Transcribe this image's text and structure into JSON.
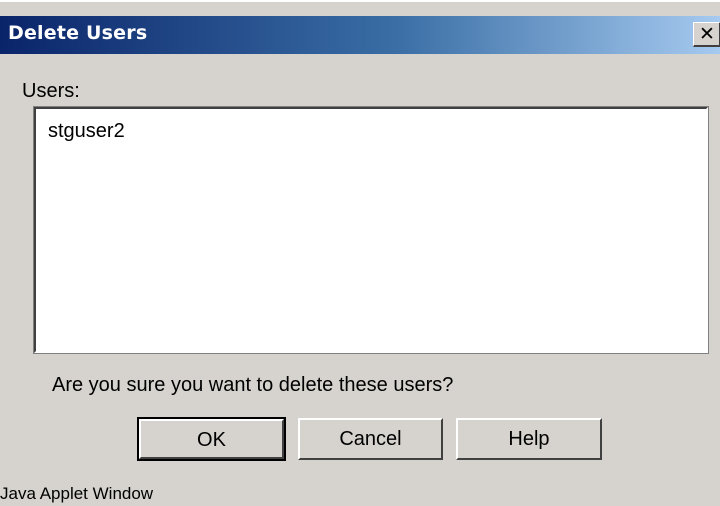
{
  "dialog": {
    "title": "Delete Users",
    "close_icon": "close-icon"
  },
  "users_label": "Users:",
  "users": [
    "stguser2"
  ],
  "confirm_message": "Are you sure you want to delete these users?",
  "buttons": {
    "ok": "OK",
    "cancel": "Cancel",
    "help": "Help"
  },
  "footer": "Java Applet Window",
  "colors": {
    "dialog_bg": "#d6d3ce",
    "titlebar_start": "#0a246a",
    "titlebar_end": "#a6caf0",
    "list_bg": "#ffffff"
  }
}
